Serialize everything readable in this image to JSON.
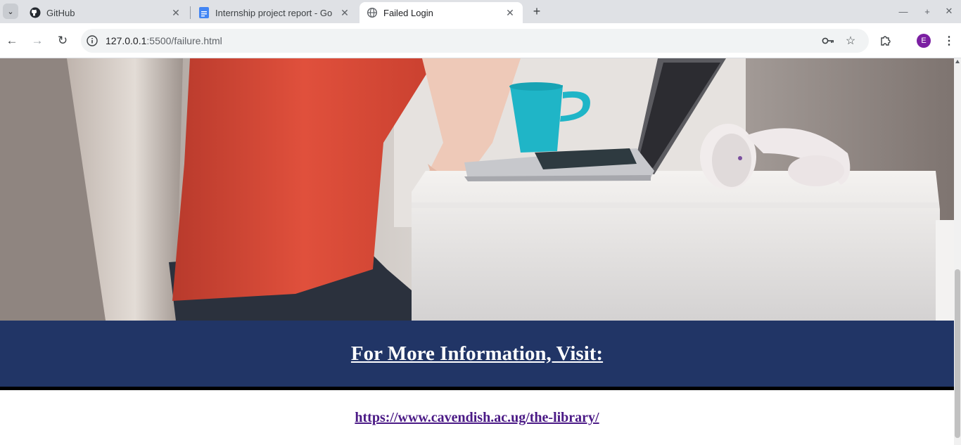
{
  "browser": {
    "tabs": [
      {
        "title": "GitHub",
        "icon": "github-icon",
        "active": false
      },
      {
        "title": "Internship project report - Go",
        "icon": "google-docs-icon",
        "active": false
      },
      {
        "title": "Failed Login",
        "icon": "globe-icon",
        "active": true
      }
    ],
    "new_tab_label": "+",
    "address": {
      "host": "127.0.0.1",
      "rest": ":5500/failure.html"
    },
    "profile_initial": "E",
    "colors": {
      "tabstrip": "#dfe1e5",
      "omnibox": "#f1f3f4",
      "avatar": "#7b1fa2"
    }
  },
  "page": {
    "hero_image": "person-at-desk-with-laptop-and-headphones",
    "info_heading": "For More Information, Visit:",
    "library_link": "https://www.cavendish.ac.ug/the-library/",
    "colors": {
      "band": "#213566",
      "link": "#4b1a86"
    }
  }
}
